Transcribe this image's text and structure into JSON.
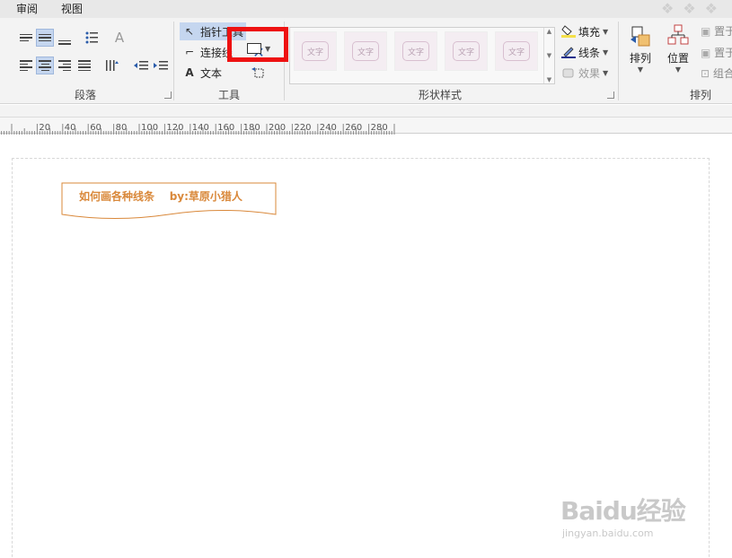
{
  "tabs": {
    "review": "审阅",
    "view": "视图"
  },
  "groups": {
    "paragraph": "段落",
    "tools": "工具",
    "shape_styles": "形状样式",
    "arrange": "排列"
  },
  "tools": {
    "pointer": "指针工具",
    "connector": "连接线",
    "text": "文本"
  },
  "style_gallery": [
    "文字",
    "文字",
    "文字",
    "文字",
    "文字"
  ],
  "format": {
    "fill": "填充",
    "line": "线条",
    "effects": "效果"
  },
  "arrange": {
    "arrange_btn": "排列",
    "position_btn": "位置",
    "bring": "置于",
    "send": "置于",
    "group": "组合"
  },
  "ruler_labels": [
    "20",
    "40",
    "60",
    "80",
    "100",
    "120",
    "140",
    "160",
    "180",
    "200",
    "220",
    "240",
    "260",
    "280"
  ],
  "banner_title": "如何画各种线条    by:草原小猎人",
  "watermark": {
    "logo": "Baidu经验",
    "url": "jingyan.baidu.com"
  },
  "colors": {
    "highlight": "#ee1111",
    "banner_text": "#d9883a",
    "banner_border": "#d9883a",
    "selected": "#c5d6ef"
  }
}
